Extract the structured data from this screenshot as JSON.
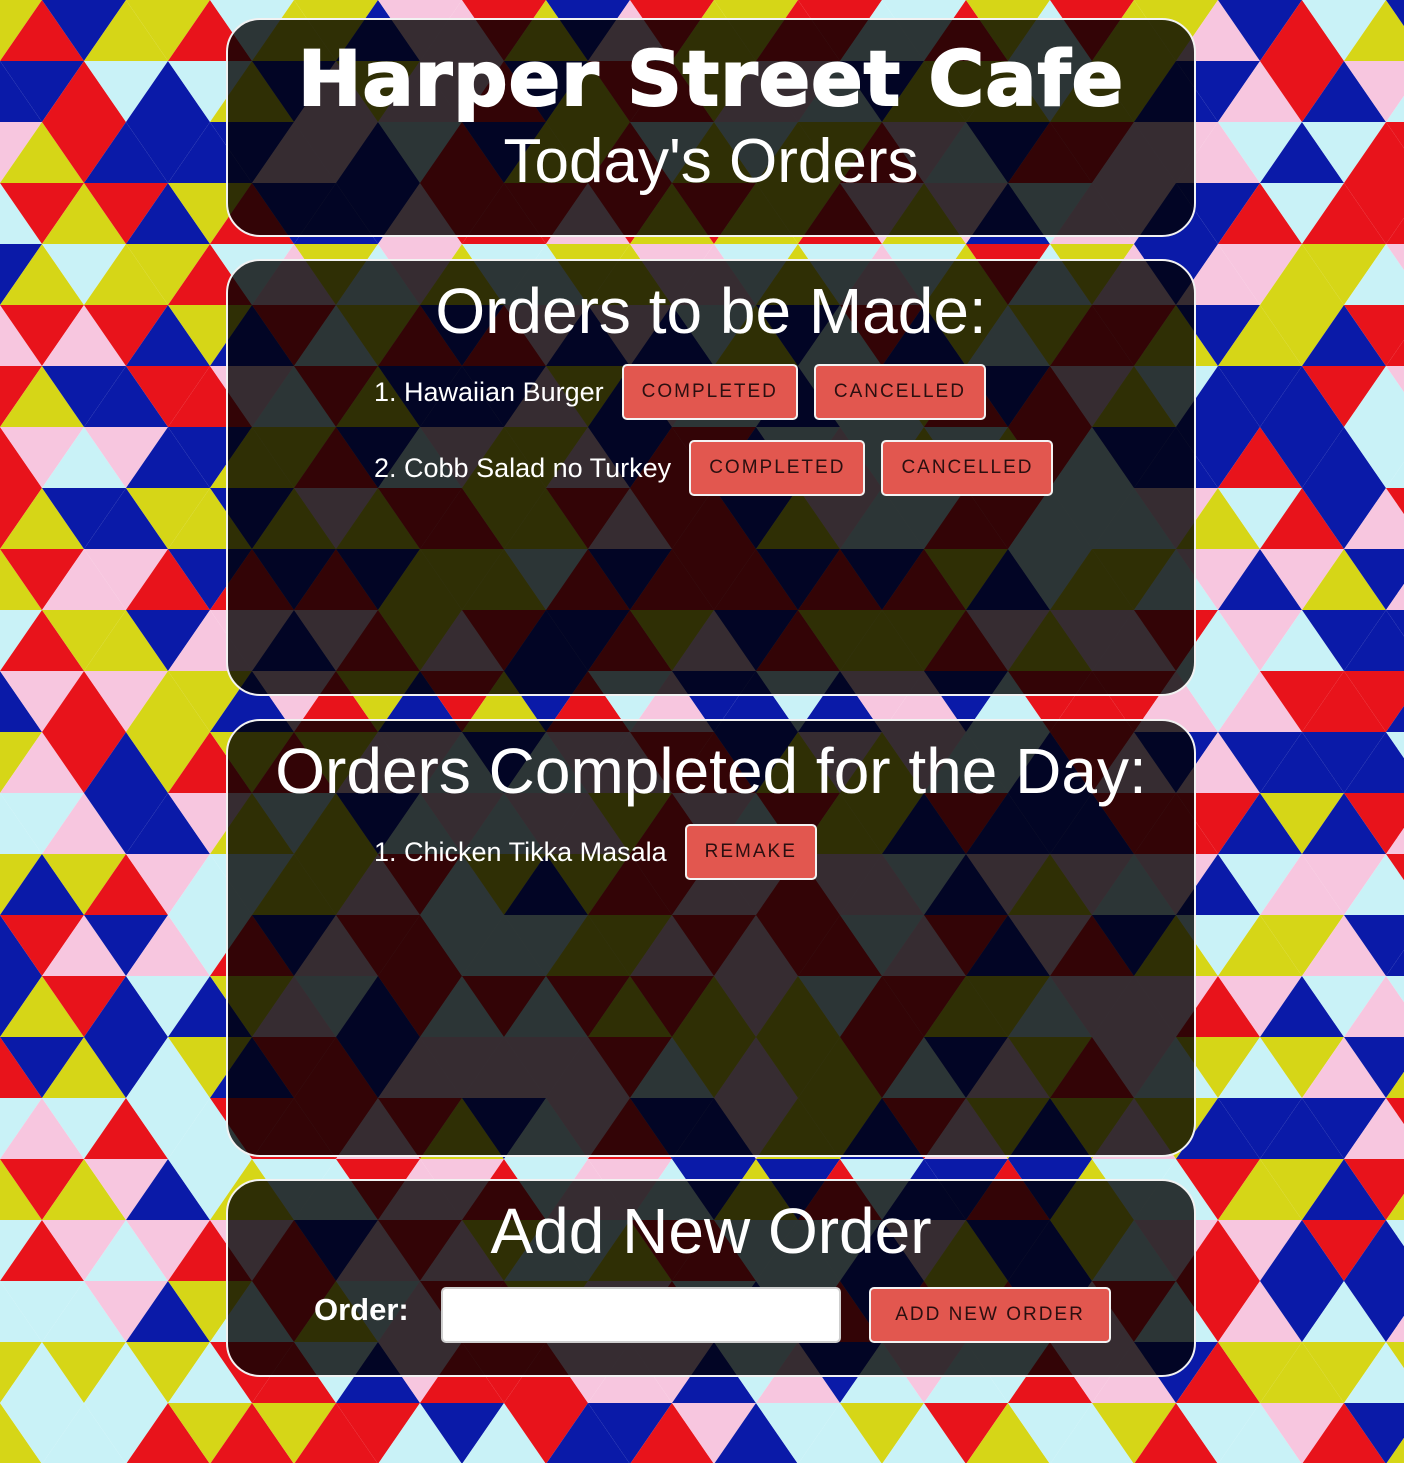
{
  "header": {
    "cafe_name": "Harper Street Cafe",
    "subtitle": "Today's Orders"
  },
  "to_make": {
    "title": "Orders to be Made:",
    "orders": [
      {
        "text": "1. Hawaiian Burger",
        "completed_label": "COMPLETED",
        "cancelled_label": "CANCELLED"
      },
      {
        "text": "2. Cobb Salad no Turkey",
        "completed_label": "COMPLETED",
        "cancelled_label": "CANCELLED"
      }
    ]
  },
  "completed": {
    "title": "Orders Completed for the Day:",
    "orders": [
      {
        "text": "1. Chicken Tikka Masala",
        "remake_label": "REMAKE"
      }
    ]
  },
  "add_order": {
    "title": "Add New Order",
    "label": "Order:",
    "input_value": "",
    "input_placeholder": "",
    "button_label": "ADD NEW ORDER"
  },
  "colors": {
    "button_bg": "#e2574f",
    "panel_bg": "rgba(0,0,0,0.78)",
    "pattern": [
      "#e8131b",
      "#0a1aa8",
      "#d6d617",
      "#f7c6df",
      "#c9f2f7"
    ]
  }
}
